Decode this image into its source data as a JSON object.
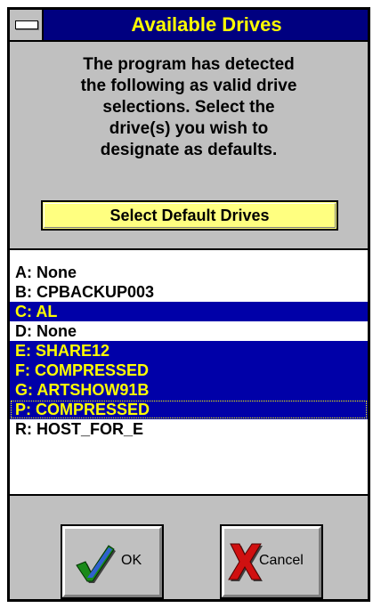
{
  "window": {
    "title": "Available Drives"
  },
  "description": [
    "The program has detected",
    "the following as valid drive",
    "selections.  Select the",
    "drive(s) you wish to",
    "designate as defaults."
  ],
  "select_button": {
    "label": "Select Default Drives"
  },
  "drives": [
    {
      "label": "A: None",
      "selected": false
    },
    {
      "label": "B: CPBACKUP003",
      "selected": false
    },
    {
      "label": "C: AL",
      "selected": true
    },
    {
      "label": "D: None",
      "selected": false
    },
    {
      "label": "E: SHARE12",
      "selected": true
    },
    {
      "label": "F: COMPRESSED",
      "selected": true
    },
    {
      "label": "G: ARTSHOW91B",
      "selected": true
    },
    {
      "label": "P: COMPRESSED",
      "selected": true,
      "focused": true
    },
    {
      "label": "R: HOST_FOR_E",
      "selected": false
    }
  ],
  "buttons": {
    "ok": {
      "label": "OK",
      "icon": "checkmark-icon"
    },
    "cancel": {
      "label": "Cancel",
      "icon": "x-icon"
    }
  },
  "colors": {
    "title_bar": "#000080",
    "title_text": "#ffff00",
    "selection_bg": "#0000a8",
    "selection_text": "#ffff00",
    "highlight_button": "#ffff80"
  }
}
